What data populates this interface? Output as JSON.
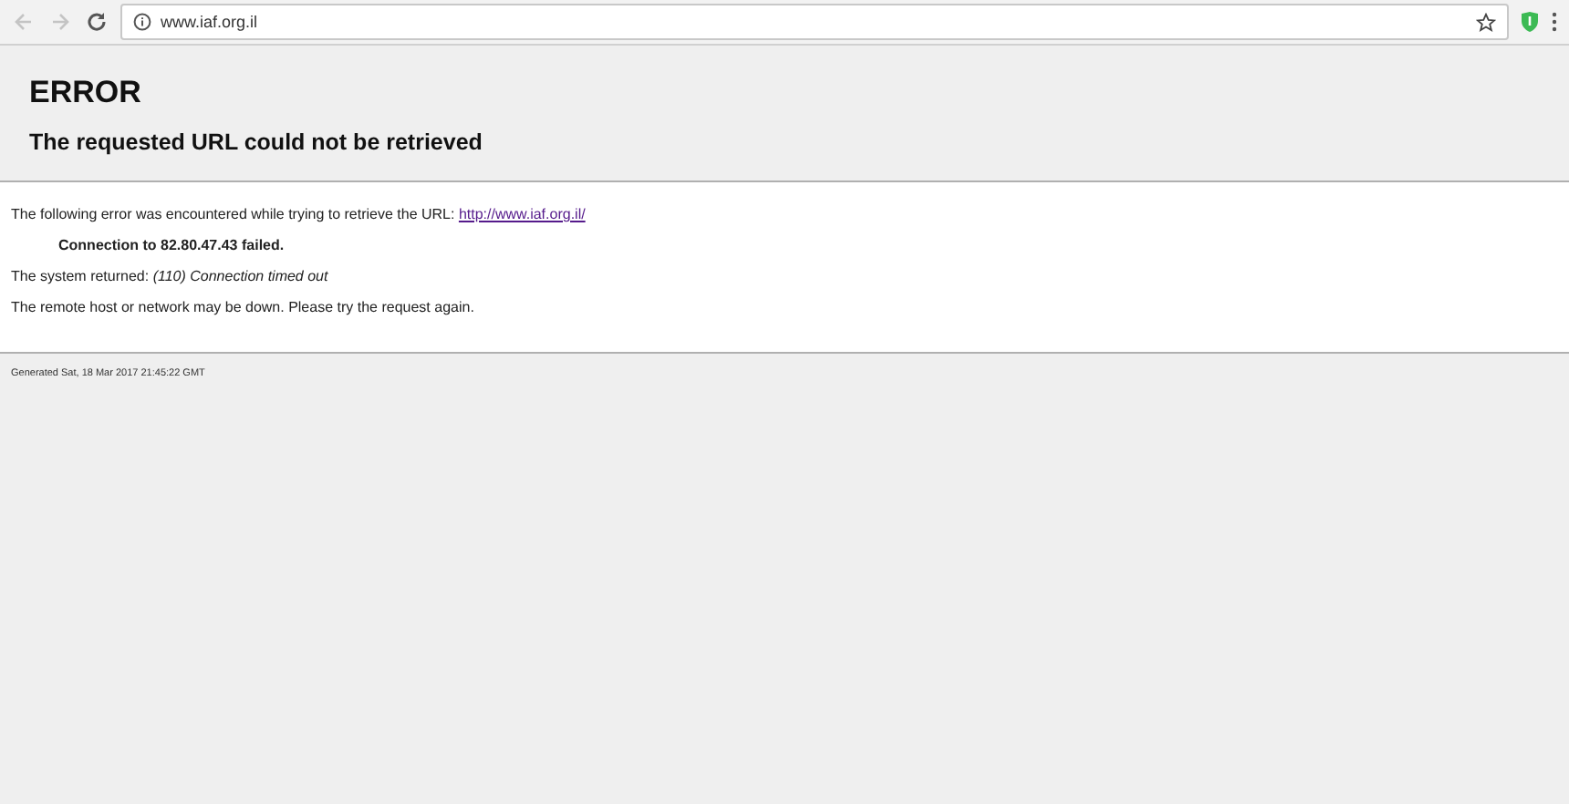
{
  "browser": {
    "back": {
      "disabled": true
    },
    "forward": {
      "disabled": true
    },
    "address": "www.iaf.org.il",
    "bookmarked": false
  },
  "header": {
    "title": "ERROR",
    "subtitle": "The requested URL could not be retrieved"
  },
  "body": {
    "intro": "The following error was encountered while trying to retrieve the URL: ",
    "link": "http://www.iaf.org.il/",
    "failure": "Connection to 82.80.47.43 failed.",
    "system": "The system returned: *(110) Connection timed out*",
    "advice": "The remote host or network may be down. Please try the request again."
  },
  "footer": "Generated Sat, 18 Mar 2017 21:45:22 GMT"
}
